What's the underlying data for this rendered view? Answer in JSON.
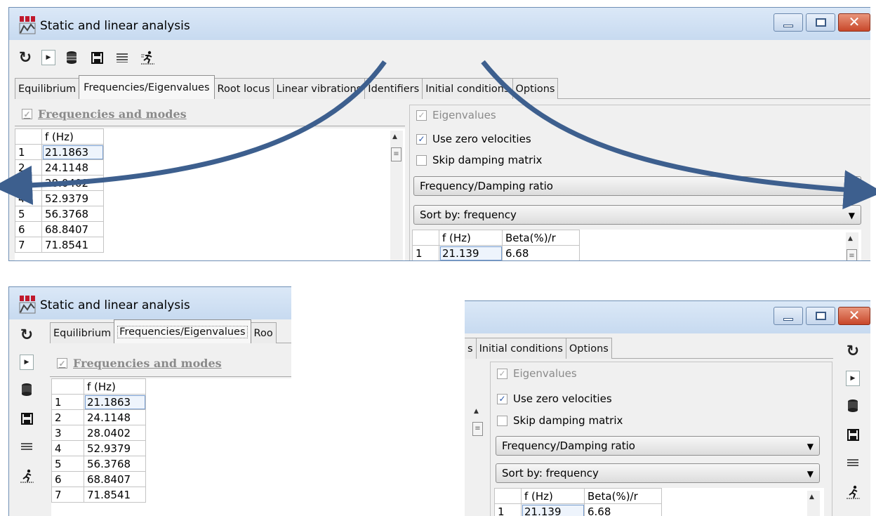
{
  "window": {
    "title": "Static and linear analysis",
    "controls": {
      "minimize": "minimize",
      "maximize": "maximize",
      "close": "✕"
    }
  },
  "toolbar": {
    "items": [
      {
        "name": "refresh-icon",
        "glyph": "↻"
      },
      {
        "name": "play-icon",
        "glyph": "▸"
      },
      {
        "name": "database-icon",
        "glyph": "🗄"
      },
      {
        "name": "save-icon",
        "glyph": "💾"
      },
      {
        "name": "list-icon",
        "glyph": "≣"
      },
      {
        "name": "run-icon",
        "glyph": "🏃"
      }
    ]
  },
  "tabs": [
    {
      "label": "Equilibrium",
      "active": false
    },
    {
      "label": "Frequencies/Eigenvalues",
      "active": true
    },
    {
      "label": "Root locus",
      "active": false
    },
    {
      "label": "Linear vibrations",
      "active": false
    },
    {
      "label": "Identifiers",
      "active": false
    },
    {
      "label": "Initial conditions",
      "active": false
    },
    {
      "label": "Options",
      "active": false
    }
  ],
  "tabs_partial": {
    "bottom_left": [
      "Equilibrium",
      "Frequencies/Eigenvalues",
      "Roo"
    ],
    "bottom_right": [
      "s",
      "Initial conditions",
      "Options"
    ]
  },
  "left_panel": {
    "section_title": "Frequencies and modes",
    "section_checked": true,
    "column_header": "f (Hz)",
    "rows": [
      {
        "idx": "1",
        "f": "21.1863"
      },
      {
        "idx": "2",
        "f": "24.1148"
      },
      {
        "idx": "3",
        "f": "28.0402"
      },
      {
        "idx": "4",
        "f": "52.9379"
      },
      {
        "idx": "5",
        "f": "56.3768"
      },
      {
        "idx": "6",
        "f": "68.8407"
      },
      {
        "idx": "7",
        "f": "71.8541"
      }
    ]
  },
  "right_panel": {
    "eigenvalues_label": "Eigenvalues",
    "eigenvalues_checked": true,
    "use_zero_velocities_label": "Use zero velocities",
    "use_zero_velocities_checked": true,
    "skip_damping_label": "Skip damping matrix",
    "skip_damping_checked": false,
    "mode_select": "Frequency/Damping ratio",
    "sort_select": "Sort by: frequency",
    "table_headers": [
      "f (Hz)",
      "Beta(%)/r"
    ],
    "rows": [
      {
        "idx": "1",
        "f": "21.139",
        "beta": "6.68"
      }
    ]
  },
  "colors": {
    "arrow": "#3d5f8e",
    "title_bar": "#c7daf0",
    "close_button": "#c8472a"
  }
}
